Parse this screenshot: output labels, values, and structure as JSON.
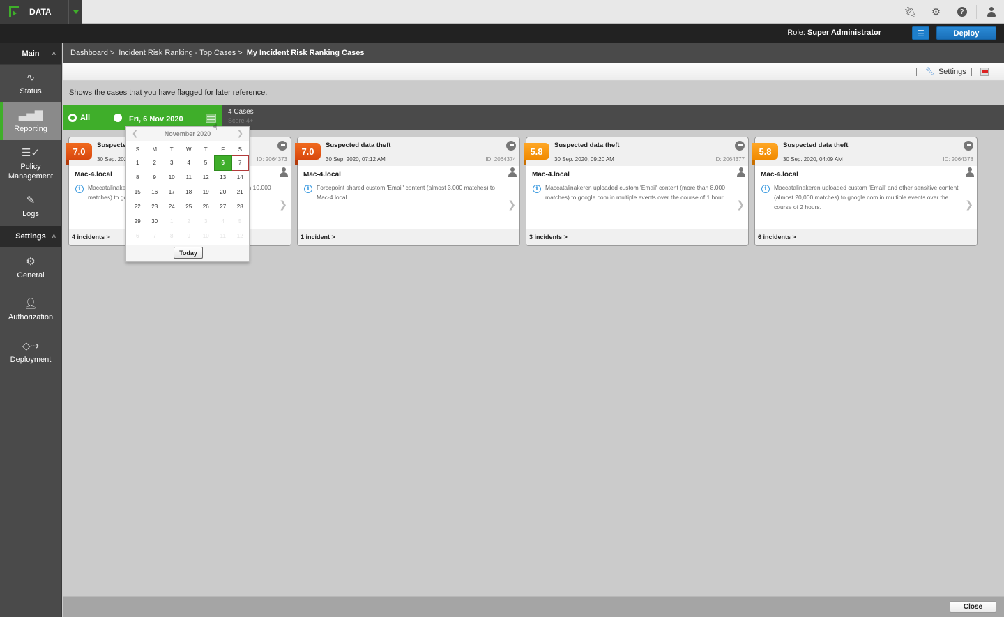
{
  "topbar": {
    "brand": "DATA",
    "icons": [
      "plug-icon",
      "gear-icon",
      "help-icon",
      "user-icon"
    ]
  },
  "rolebar": {
    "role_label": "Role:",
    "role_value": "Super Administrator",
    "deploy_label": "Deploy"
  },
  "sidebar": {
    "main_header": "Main",
    "main_items": [
      {
        "label": "Status",
        "icon": "pulse-icon"
      },
      {
        "label": "Reporting",
        "icon": "bar-chart-icon",
        "active": true
      },
      {
        "label": "Policy Management",
        "icon": "checklist-icon"
      },
      {
        "label": "Logs",
        "icon": "log-edit-icon"
      }
    ],
    "settings_header": "Settings",
    "settings_items": [
      {
        "label": "General",
        "icon": "gear-icon"
      },
      {
        "label": "Authorization",
        "icon": "user-key-icon"
      },
      {
        "label": "Deployment",
        "icon": "deployment-icon"
      }
    ]
  },
  "breadcrumb": {
    "items": [
      "Dashboard >",
      "Incident Risk Ranking - Top Cases >"
    ],
    "current": "My Incident Risk Ranking Cases"
  },
  "toolbar": {
    "settings_label": "Settings"
  },
  "content": {
    "description": "Shows the cases that you have flagged for later reference.",
    "filter": {
      "all_label": "All",
      "date_label": "Fri, 6 Nov 2020",
      "selected": "All",
      "cases_count": "4 Cases",
      "score_label": "Score 4+"
    },
    "cards": [
      {
        "score": "7.0",
        "severity": "high",
        "title": "Suspected data theft",
        "date": "30 Sep. 2020, 06:55 AM",
        "id": "ID: 2064373",
        "host": "Mac-4.local",
        "description": "Maccatalinakeren uploaded custom 'Email' content (more than 10,000 matches) to google.com.",
        "incidents": "4 incidents >"
      },
      {
        "score": "7.0",
        "severity": "high",
        "title": "Suspected data theft",
        "date": "30 Sep. 2020, 07:12 AM",
        "id": "ID: 2064374",
        "host": "Mac-4.local",
        "description": "Forcepoint shared custom 'Email' content (almost 3,000 matches) to Mac-4.local.",
        "incidents": "1 incident >"
      },
      {
        "score": "5.8",
        "severity": "med",
        "title": "Suspected data theft",
        "date": "30 Sep. 2020, 09:20 AM",
        "id": "ID: 2064377",
        "host": "Mac-4.local",
        "description": "Maccatalinakeren uploaded custom 'Email' content (more than 8,000 matches) to google.com in multiple events over the course of 1 hour.",
        "incidents": "3 incidents >"
      },
      {
        "score": "5.8",
        "severity": "med",
        "title": "Suspected data theft",
        "date": "30 Sep. 2020, 04:09 AM",
        "id": "ID: 2064378",
        "host": "Mac-4.local",
        "description": "Maccatalinakeren uploaded custom 'Email' and other sensitive content (almost 20,000 matches) to google.com in multiple events over the course of 2 hours.",
        "incidents": "6 incidents >"
      }
    ]
  },
  "calendar": {
    "month": "November 2020",
    "prev": "❮",
    "next": "❯",
    "weekdays": [
      "S",
      "M",
      "T",
      "W",
      "T",
      "F",
      "S"
    ],
    "selected_day": 6,
    "today_day": 7,
    "weeks": [
      [
        "1",
        "2",
        "3",
        "4",
        "5",
        "6",
        "7"
      ],
      [
        "8",
        "9",
        "10",
        "11",
        "12",
        "13",
        "14"
      ],
      [
        "15",
        "16",
        "17",
        "18",
        "19",
        "20",
        "21"
      ],
      [
        "22",
        "23",
        "24",
        "25",
        "26",
        "27",
        "28"
      ],
      [
        "29",
        "30",
        "1",
        "2",
        "3",
        "4",
        "5"
      ],
      [
        "6",
        "7",
        "8",
        "9",
        "10",
        "11",
        "12"
      ]
    ],
    "today_label": "Today"
  },
  "footer": {
    "close_label": "Close"
  }
}
